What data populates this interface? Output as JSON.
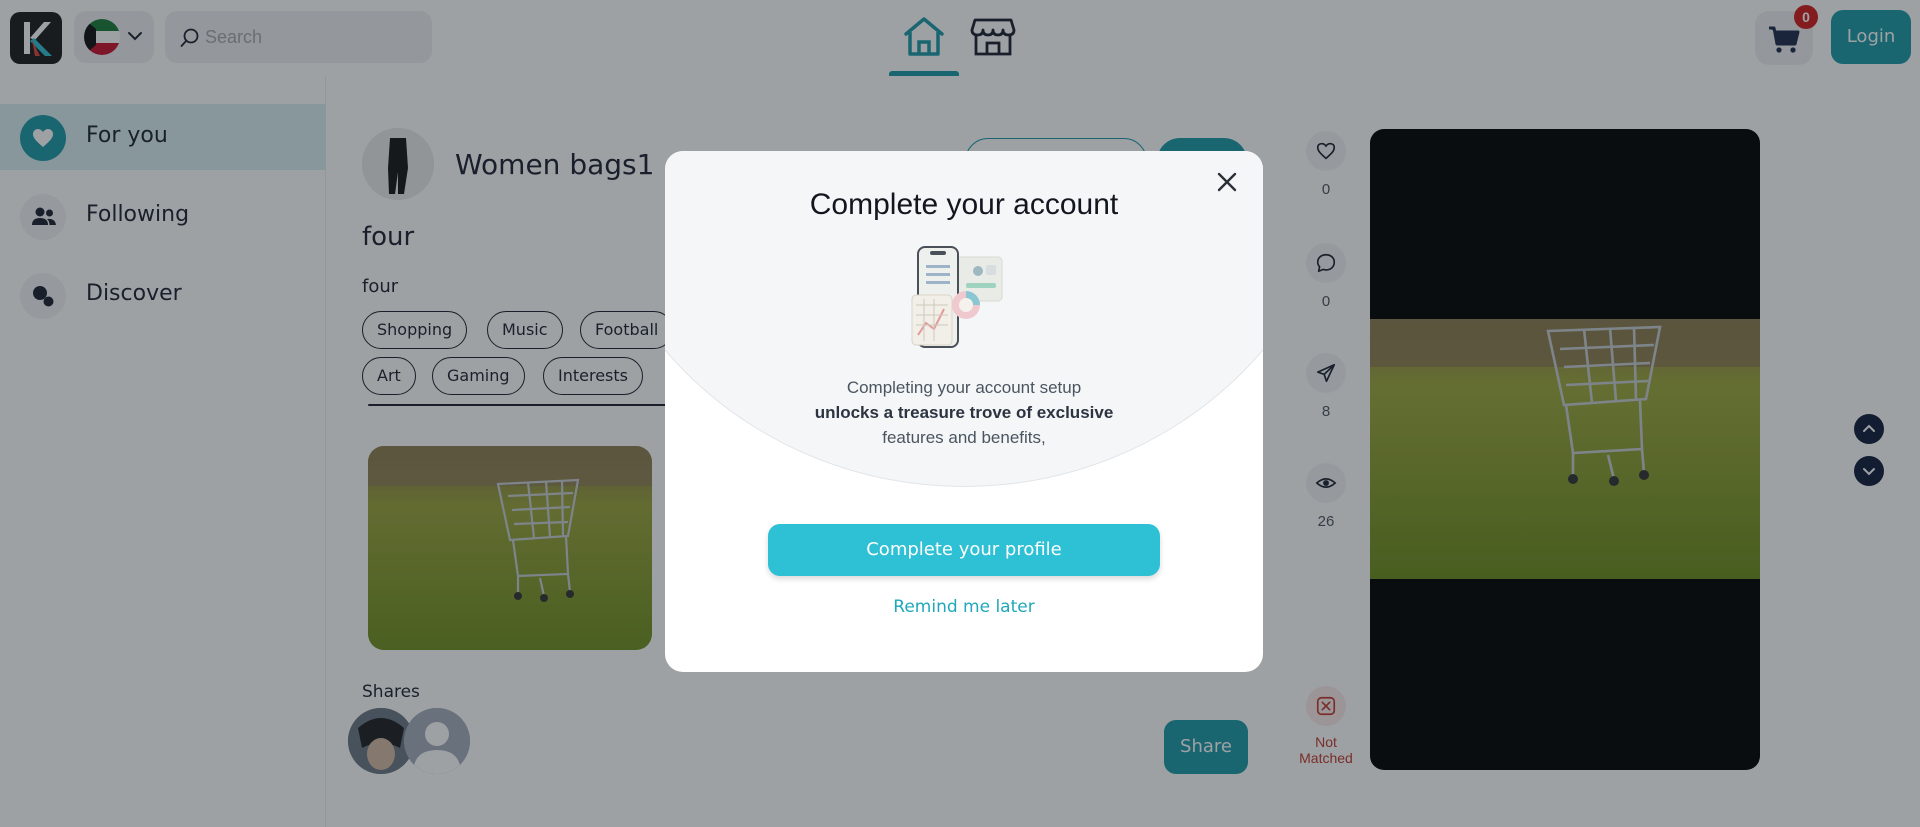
{
  "header": {
    "search_placeholder": "Search",
    "cart_count": "0",
    "login_label": "Login",
    "icons": [
      "app-logo",
      "kuwait-flag-icon",
      "chevron-down-icon",
      "search-icon",
      "home-icon",
      "store-icon",
      "cart-icon"
    ]
  },
  "sidebar": {
    "items": [
      {
        "label": "For you",
        "icon": "heart-icon",
        "active": true
      },
      {
        "label": "Following",
        "icon": "people-icon",
        "active": false
      },
      {
        "label": "Discover",
        "icon": "discover-icon",
        "active": false
      }
    ]
  },
  "post": {
    "author": "Women bags1",
    "title": "four",
    "description": "four",
    "tags_row1": [
      "Shopping",
      "Music",
      "Football"
    ],
    "tags_row2": [
      "Art",
      "Gaming",
      "Interests"
    ],
    "shares_label": "Shares",
    "share_button": "Share"
  },
  "actions": {
    "likes": "0",
    "comments": "0",
    "shares": "8",
    "views": "26",
    "not_matched": "Not Matched"
  },
  "modal": {
    "title": "Complete your account",
    "text_line1": "Completing your account setup",
    "text_bold": "unlocks a treasure trove of exclusive",
    "text_line3": "features and benefits,",
    "primary_button": "Complete your profile",
    "secondary_link": "Remind me later"
  },
  "colors": {
    "accent": "#1a9aa8",
    "modal_button": "#2ec0d4",
    "badge": "#d11a1a",
    "danger": "#c0392b"
  }
}
